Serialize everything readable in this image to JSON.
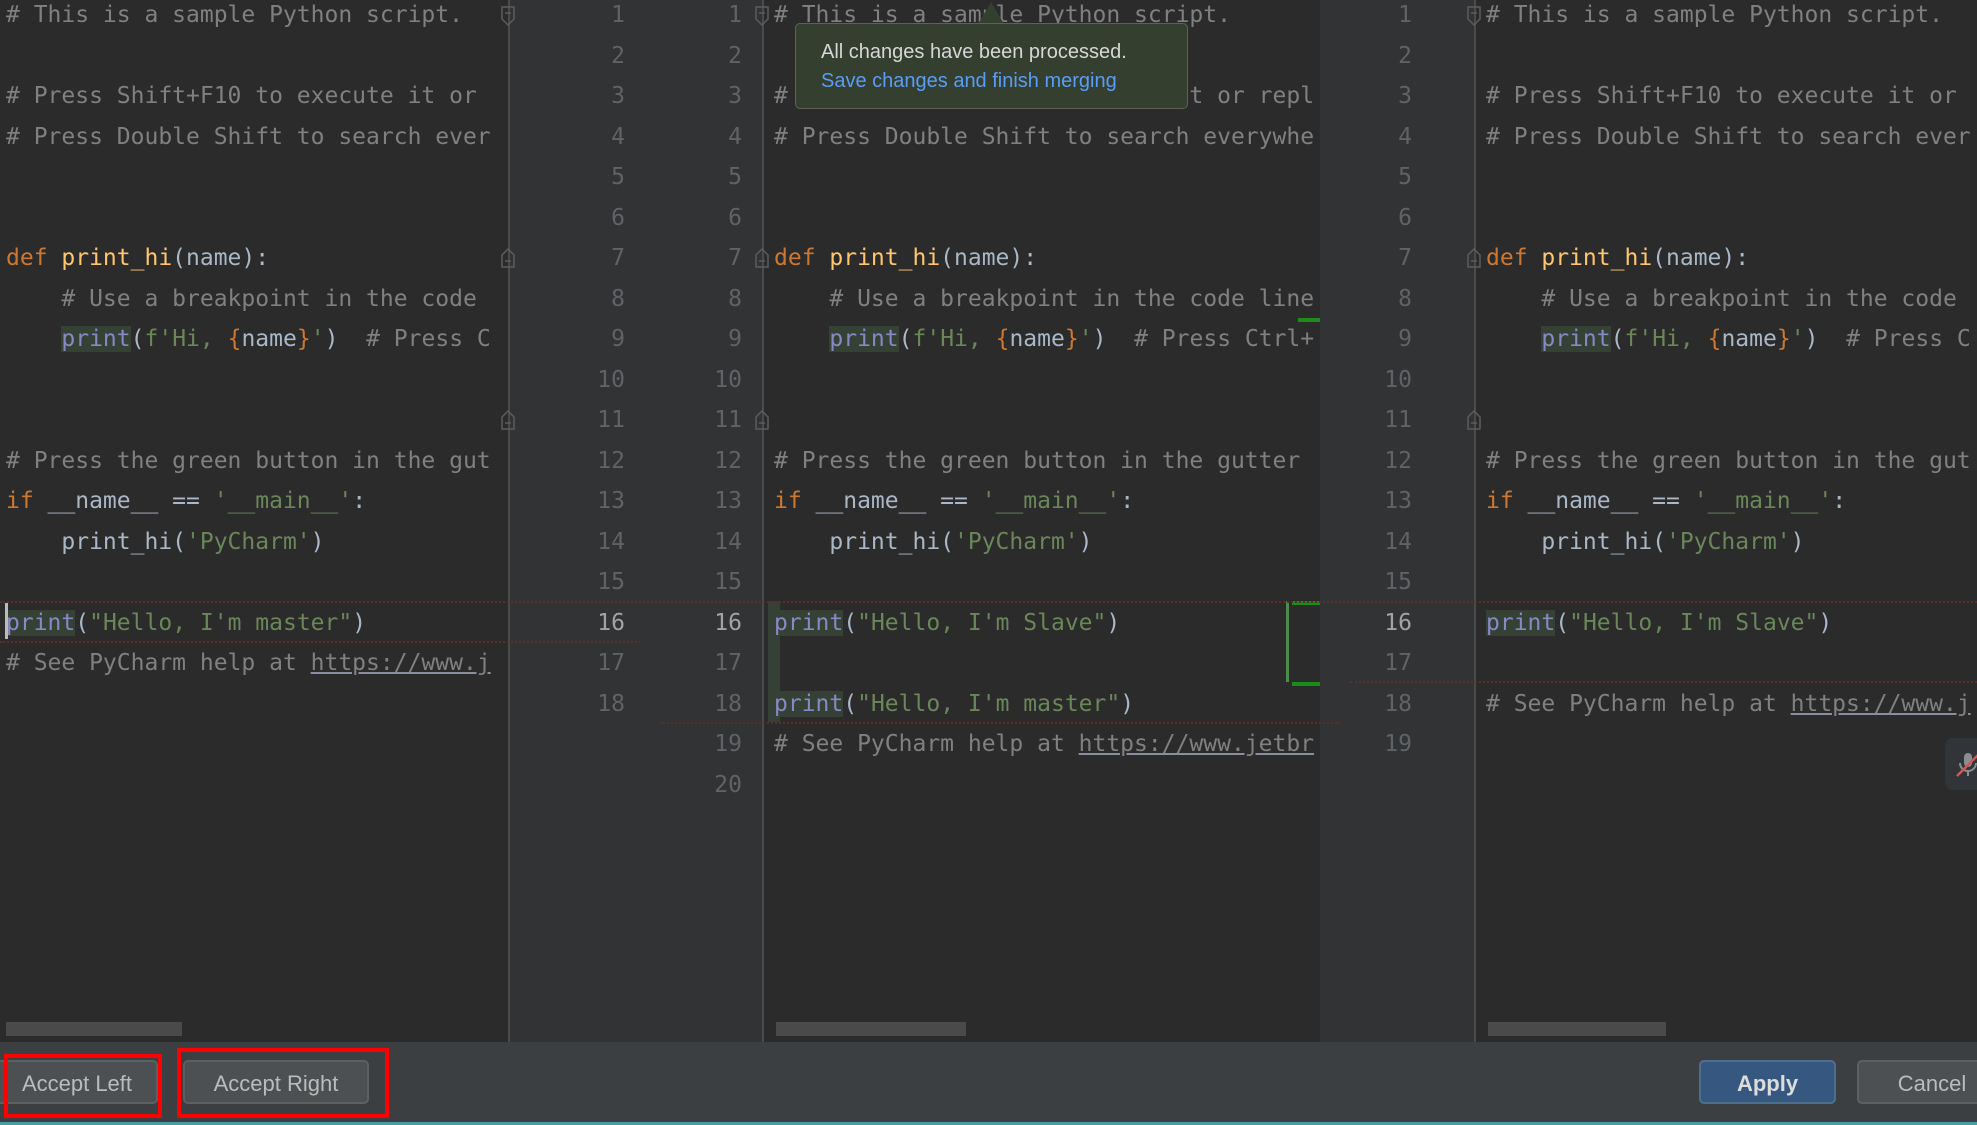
{
  "left_pane": {
    "lines": [
      {
        "n": 1,
        "parts": [
          {
            "t": "# This is a sample Python script.",
            "c": "cm"
          }
        ]
      },
      {
        "n": 2,
        "parts": []
      },
      {
        "n": 3,
        "parts": [
          {
            "t": "# Press Shift+F10 to execute it or ",
            "c": "cm"
          }
        ]
      },
      {
        "n": 4,
        "parts": [
          {
            "t": "# Press Double Shift to search ever",
            "c": "cm"
          }
        ]
      },
      {
        "n": 5,
        "parts": []
      },
      {
        "n": 6,
        "parts": []
      },
      {
        "n": 7,
        "parts": [
          {
            "t": "def ",
            "c": "kw"
          },
          {
            "t": "print_hi",
            "c": "fn"
          },
          {
            "t": "(name):",
            "c": ""
          }
        ]
      },
      {
        "n": 8,
        "parts": [
          {
            "t": "    # Use a breakpoint in the code ",
            "c": "cm"
          }
        ]
      },
      {
        "n": 9,
        "parts": [
          {
            "t": "    ",
            "c": ""
          },
          {
            "t": "print",
            "c": "bi hl"
          },
          {
            "t": "(",
            "c": ""
          },
          {
            "t": "f'Hi, ",
            "c": "st"
          },
          {
            "t": "{",
            "c": "br"
          },
          {
            "t": "name",
            "c": ""
          },
          {
            "t": "}",
            "c": "br"
          },
          {
            "t": "'",
            "c": "st"
          },
          {
            "t": ")  ",
            "c": ""
          },
          {
            "t": "# Press C",
            "c": "cm"
          }
        ]
      },
      {
        "n": 10,
        "parts": []
      },
      {
        "n": 11,
        "parts": []
      },
      {
        "n": 12,
        "parts": [
          {
            "t": "# Press the green button in the gut",
            "c": "cm"
          }
        ]
      },
      {
        "n": 13,
        "parts": [
          {
            "t": "if ",
            "c": "kw"
          },
          {
            "t": "__name__ == ",
            "c": ""
          },
          {
            "t": "'__main__'",
            "c": "st"
          },
          {
            "t": ":",
            "c": ""
          }
        ]
      },
      {
        "n": 14,
        "parts": [
          {
            "t": "    print_hi(",
            "c": ""
          },
          {
            "t": "'PyCharm'",
            "c": "st"
          },
          {
            "t": ")",
            "c": ""
          }
        ]
      },
      {
        "n": 15,
        "parts": []
      },
      {
        "n": 16,
        "parts": [
          {
            "t": "print",
            "c": "bi hl"
          },
          {
            "t": "(",
            "c": ""
          },
          {
            "t": "\"Hello, I'm master\"",
            "c": "st"
          },
          {
            "t": ")",
            "c": ""
          }
        ]
      },
      {
        "n": 17,
        "parts": [
          {
            "t": "# See PyCharm help at ",
            "c": "cm"
          },
          {
            "t": "https://www.j",
            "c": "url"
          }
        ]
      },
      {
        "n": 18,
        "parts": []
      }
    ]
  },
  "middle_pane": {
    "lines": [
      {
        "n": 1,
        "parts": [
          {
            "t": "# This is a sample Python script.",
            "c": "cm"
          }
        ]
      },
      {
        "n": 2,
        "parts": []
      },
      {
        "n": 3,
        "parts": [
          {
            "t": "# Press Shift+F10 to execute it or repl",
            "c": "cm"
          }
        ]
      },
      {
        "n": 4,
        "parts": [
          {
            "t": "# Press Double Shift to search everywhe",
            "c": "cm"
          }
        ]
      },
      {
        "n": 5,
        "parts": []
      },
      {
        "n": 6,
        "parts": []
      },
      {
        "n": 7,
        "parts": [
          {
            "t": "def ",
            "c": "kw"
          },
          {
            "t": "print_hi",
            "c": "fn"
          },
          {
            "t": "(name):",
            "c": ""
          }
        ]
      },
      {
        "n": 8,
        "parts": [
          {
            "t": "    # Use a breakpoint in the code line",
            "c": "cm"
          }
        ]
      },
      {
        "n": 9,
        "parts": [
          {
            "t": "    ",
            "c": ""
          },
          {
            "t": "print",
            "c": "bi hl"
          },
          {
            "t": "(",
            "c": ""
          },
          {
            "t": "f'Hi, ",
            "c": "st"
          },
          {
            "t": "{",
            "c": "br"
          },
          {
            "t": "name",
            "c": ""
          },
          {
            "t": "}",
            "c": "br"
          },
          {
            "t": "'",
            "c": "st"
          },
          {
            "t": ")  ",
            "c": ""
          },
          {
            "t": "# Press Ctrl+",
            "c": "cm"
          }
        ]
      },
      {
        "n": 10,
        "parts": []
      },
      {
        "n": 11,
        "parts": []
      },
      {
        "n": 12,
        "parts": [
          {
            "t": "# Press the green button in the gutter ",
            "c": "cm"
          }
        ]
      },
      {
        "n": 13,
        "parts": [
          {
            "t": "if ",
            "c": "kw"
          },
          {
            "t": "__name__ == ",
            "c": ""
          },
          {
            "t": "'__main__'",
            "c": "st"
          },
          {
            "t": ":",
            "c": ""
          }
        ]
      },
      {
        "n": 14,
        "parts": [
          {
            "t": "    print_hi(",
            "c": ""
          },
          {
            "t": "'PyCharm'",
            "c": "st"
          },
          {
            "t": ")",
            "c": ""
          }
        ]
      },
      {
        "n": 15,
        "parts": []
      },
      {
        "n": 16,
        "parts": [
          {
            "t": "print",
            "c": "bi hl"
          },
          {
            "t": "(",
            "c": ""
          },
          {
            "t": "\"Hello, I'm Slave\"",
            "c": "st"
          },
          {
            "t": ")",
            "c": ""
          }
        ]
      },
      {
        "n": 17,
        "parts": []
      },
      {
        "n": 18,
        "parts": [
          {
            "t": "print",
            "c": "bi hl"
          },
          {
            "t": "(",
            "c": ""
          },
          {
            "t": "\"Hello, I'm master\"",
            "c": "st"
          },
          {
            "t": ")",
            "c": ""
          }
        ]
      },
      {
        "n": 19,
        "parts": [
          {
            "t": "# See PyCharm help at ",
            "c": "cm"
          },
          {
            "t": "https://www.jetbr",
            "c": "url"
          }
        ]
      },
      {
        "n": 20,
        "parts": []
      }
    ]
  },
  "right_pane": {
    "lines": [
      {
        "n": 1,
        "parts": [
          {
            "t": "# This is a sample Python script.",
            "c": "cm"
          }
        ]
      },
      {
        "n": 2,
        "parts": []
      },
      {
        "n": 3,
        "parts": [
          {
            "t": "# Press Shift+F10 to execute it or ",
            "c": "cm"
          }
        ]
      },
      {
        "n": 4,
        "parts": [
          {
            "t": "# Press Double Shift to search ever",
            "c": "cm"
          }
        ]
      },
      {
        "n": 5,
        "parts": []
      },
      {
        "n": 6,
        "parts": []
      },
      {
        "n": 7,
        "parts": [
          {
            "t": "def ",
            "c": "kw"
          },
          {
            "t": "print_hi",
            "c": "fn"
          },
          {
            "t": "(name):",
            "c": ""
          }
        ]
      },
      {
        "n": 8,
        "parts": [
          {
            "t": "    # Use a breakpoint in the code ",
            "c": "cm"
          }
        ]
      },
      {
        "n": 9,
        "parts": [
          {
            "t": "    ",
            "c": ""
          },
          {
            "t": "print",
            "c": "bi hl"
          },
          {
            "t": "(",
            "c": ""
          },
          {
            "t": "f'Hi, ",
            "c": "st"
          },
          {
            "t": "{",
            "c": "br"
          },
          {
            "t": "name",
            "c": ""
          },
          {
            "t": "}",
            "c": "br"
          },
          {
            "t": "'",
            "c": "st"
          },
          {
            "t": ")  ",
            "c": ""
          },
          {
            "t": "# Press C",
            "c": "cm"
          }
        ]
      },
      {
        "n": 10,
        "parts": []
      },
      {
        "n": 11,
        "parts": []
      },
      {
        "n": 12,
        "parts": [
          {
            "t": "# Press the green button in the gut",
            "c": "cm"
          }
        ]
      },
      {
        "n": 13,
        "parts": [
          {
            "t": "if ",
            "c": "kw"
          },
          {
            "t": "__name__ == ",
            "c": ""
          },
          {
            "t": "'__main__'",
            "c": "st"
          },
          {
            "t": ":",
            "c": ""
          }
        ]
      },
      {
        "n": 14,
        "parts": [
          {
            "t": "    print_hi(",
            "c": ""
          },
          {
            "t": "'PyCharm'",
            "c": "st"
          },
          {
            "t": ")",
            "c": ""
          }
        ]
      },
      {
        "n": 15,
        "parts": []
      },
      {
        "n": 16,
        "parts": [
          {
            "t": "print",
            "c": "bi hl"
          },
          {
            "t": "(",
            "c": ""
          },
          {
            "t": "\"Hello, I'm Slave\"",
            "c": "st"
          },
          {
            "t": ")",
            "c": ""
          }
        ]
      },
      {
        "n": 17,
        "parts": []
      },
      {
        "n": 18,
        "parts": [
          {
            "t": "# See PyCharm help at ",
            "c": "cm"
          },
          {
            "t": "https://www.j",
            "c": "url"
          }
        ]
      },
      {
        "n": 19,
        "parts": []
      }
    ]
  },
  "current_line": 16,
  "notification": {
    "message": "All changes have been processed.",
    "link": "Save changes and finish merging"
  },
  "toolbar": {
    "accept_left": "Accept Left",
    "accept_right": "Accept Right",
    "apply": "Apply",
    "cancel": "Cancel"
  },
  "icons": {
    "mic": "microphone-muted-icon"
  },
  "colors": {
    "accent": "#365880",
    "highlight_box": "#ff0000",
    "link": "#589df6"
  }
}
